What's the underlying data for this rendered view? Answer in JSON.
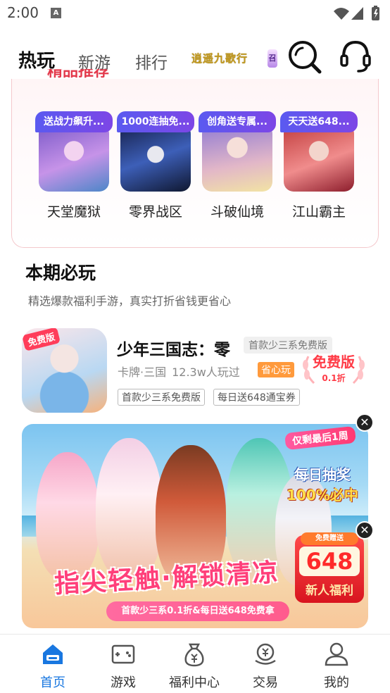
{
  "status_bar": {
    "time": "2:00",
    "notification_icon": "A"
  },
  "top_nav": {
    "tabs": [
      {
        "label": "热玩",
        "active": true
      },
      {
        "label": "新游",
        "active": false
      },
      {
        "label": "排行",
        "active": false
      }
    ],
    "brand_text": "逍遥九歌行",
    "icons": [
      "search-icon",
      "customer-service-icon"
    ]
  },
  "recommend": {
    "title": "精品推荐",
    "games": [
      {
        "badge": "送战力飙升...",
        "name": "天堂魔狱"
      },
      {
        "badge": "1000连抽免...",
        "name": "零界战区"
      },
      {
        "badge": "创角送专属...",
        "name": "斗破仙境"
      },
      {
        "badge": "天天送648...",
        "name": "江山霸主"
      }
    ]
  },
  "must_play": {
    "title": "本期必玩",
    "subtitle": "精选爆款福利手游，真实打折省钱更省心"
  },
  "featured_game": {
    "icon_tag": "免费版",
    "name": "少年三国志：零",
    "tag": "首款少三系免费版",
    "category": "卡牌·三国",
    "players": "12.3w人玩过",
    "save_label": "省心玩",
    "free_label": "免费版",
    "discount": "0.1折",
    "chips": [
      "首款少三系免费版",
      "每日送648通宝券"
    ]
  },
  "banner": {
    "last_week": "仅剩最后1周",
    "daily_1": "每日抽奖",
    "daily_2": "100%必中",
    "gift_top": "免费赠送",
    "gift_number": "648",
    "gift_label": "新人福利",
    "slogan": "指尖轻触·解锁清凉",
    "bottom_text": "首款少三系0.1折&每日送648免费拿"
  },
  "bottom_nav": [
    {
      "label": "首页",
      "icon": "home-icon",
      "active": true
    },
    {
      "label": "游戏",
      "icon": "gamepad-icon",
      "active": false
    },
    {
      "label": "福利中心",
      "icon": "money-bag-icon",
      "active": false
    },
    {
      "label": "交易",
      "icon": "trade-icon",
      "active": false
    },
    {
      "label": "我的",
      "icon": "profile-icon",
      "active": false
    }
  ],
  "colors": {
    "accent": "#1977e0",
    "badge": "#6a4ff0",
    "highlight": "#ff3b46"
  }
}
